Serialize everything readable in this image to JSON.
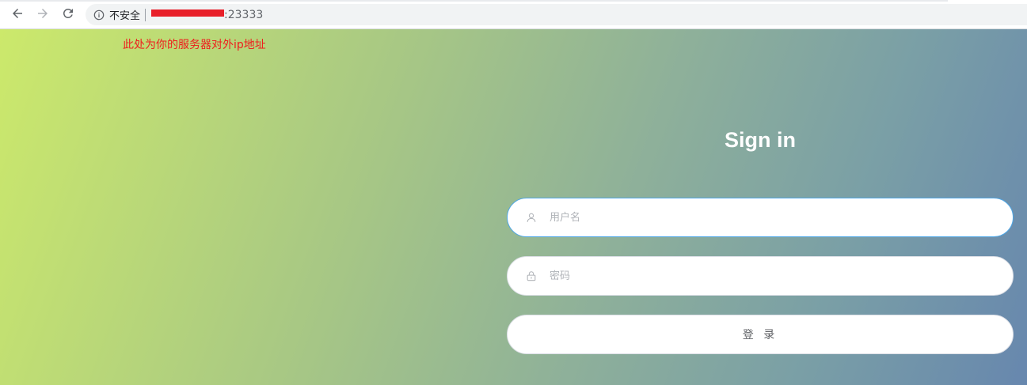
{
  "browser": {
    "security_label": "不安全",
    "url_port": ":23333",
    "icons": {
      "back": "back-arrow-icon",
      "forward": "forward-arrow-icon",
      "reload": "reload-icon",
      "info": "info-icon"
    }
  },
  "page": {
    "annotation": "此处为你的服务器对外ip地址",
    "title": "Sign in",
    "username_placeholder": "用户名",
    "password_placeholder": "密码",
    "login_label": "登 录",
    "icons": {
      "user": "user-icon",
      "lock": "lock-icon"
    }
  },
  "colors": {
    "annotation": "#ef1d1d",
    "redaction": "#e8202a",
    "focus_border": "#4da6e6",
    "gradient_start": "#cce96b",
    "gradient_end": "#6787ae"
  }
}
